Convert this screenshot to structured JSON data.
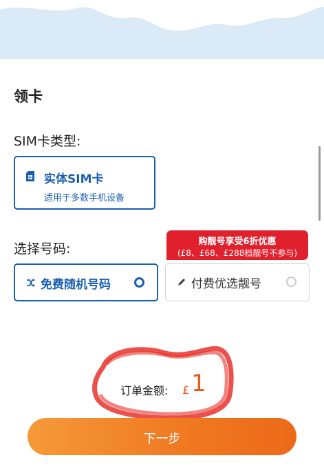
{
  "section": {
    "title": "领卡"
  },
  "sim_type": {
    "label": "SIM卡类型:",
    "card": {
      "title": "实体SIM卡",
      "description": "适用于多数手机设备"
    }
  },
  "number_select": {
    "label": "选择号码:",
    "promo": {
      "title": "购靓号享受6折优惠",
      "note": "(£8、£68、£288档靓号不参与)"
    },
    "options": [
      {
        "label": "免费随机号码",
        "icon": "shuffle-icon",
        "selected": true
      },
      {
        "label": "付费优选靓号",
        "icon": "pencil-icon",
        "selected": false
      }
    ]
  },
  "order": {
    "total_label": "订单金额:",
    "currency": "£",
    "amount": "1"
  },
  "next_button": {
    "label": "下一步"
  },
  "colors": {
    "primary": "#1a5fb0",
    "accent": "#e85a1c",
    "promo": "#e0202d",
    "banner": "#dbeaf7",
    "scribble": "#e8322a"
  }
}
